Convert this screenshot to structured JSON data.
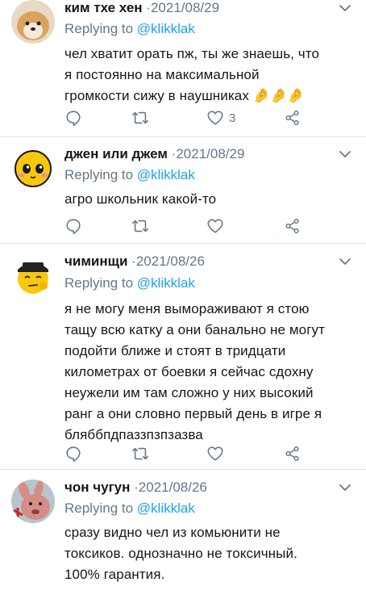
{
  "tweets": [
    {
      "name": "ким тхе хен",
      "date": "2021/08/29",
      "replying_label": "Replying to",
      "handle": "@klikklak",
      "text_lines": [
        "чел хватит орать пж, ты же знаешь, что",
        "я постоянно на максимальной",
        "громкости сижу в наушниках 🤌🤌🤌"
      ],
      "like_count": "3"
    },
    {
      "name": "джен или джем",
      "date": "2021/08/29",
      "replying_label": "Replying to",
      "handle": "@klikklak",
      "text_lines": [
        "агро школьник какой-то"
      ],
      "like_count": ""
    },
    {
      "name": "чиминщи",
      "date": "2021/08/26",
      "replying_label": "Replying to",
      "handle": "@klikklak",
      "text_lines": [
        "я не могу меня вымораживают я стою",
        "тащу всю катку а они банально не могут",
        "подойти ближе и стоят в тридцати",
        "километрах от боевки я сейчас сдохну",
        "неужели им там сложно у них высокий",
        "ранг а они словно первый день в игре я",
        "бляббпдпаззпзпзазва"
      ],
      "like_count": ""
    },
    {
      "name": "чон чугун",
      "date": "2021/08/26",
      "replying_label": "Replying to",
      "handle": "@klikklak",
      "text_lines": [
        "сразу видно чел из комьюнити не",
        "токсиков. однозначно не токсичный.",
        "100% гарантия."
      ],
      "like_count": ""
    }
  ],
  "separator": "·",
  "icons": [
    "chevron-down-icon",
    "reply-icon",
    "retweet-icon",
    "heart-icon",
    "share-icon"
  ],
  "colors": {
    "secondary_text": "#657786",
    "link": "#1da1f2",
    "divider": "#e1e8ed"
  }
}
